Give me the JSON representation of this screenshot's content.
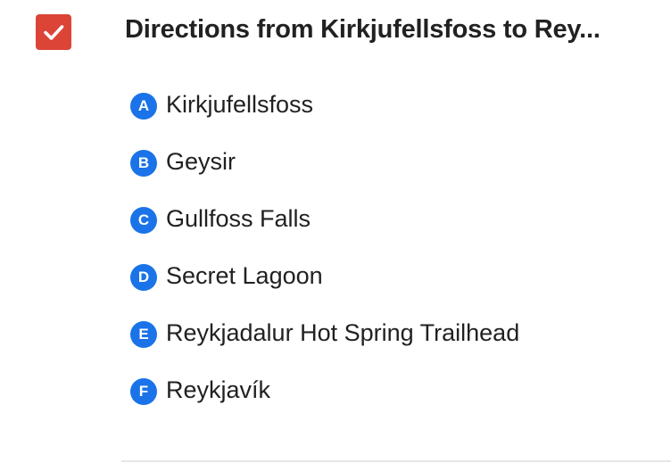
{
  "layer": {
    "checked": true,
    "checkbox_color": "#db4437",
    "title": "Directions from Kirkjufellsfoss to Rey..."
  },
  "marker_color": "#1a73e8",
  "stops": [
    {
      "letter": "A",
      "name": "Kirkjufellsfoss"
    },
    {
      "letter": "B",
      "name": "Geysir"
    },
    {
      "letter": "C",
      "name": "Gullfoss Falls"
    },
    {
      "letter": "D",
      "name": "Secret Lagoon"
    },
    {
      "letter": "E",
      "name": "Reykjadalur Hot Spring Trailhead"
    },
    {
      "letter": "F",
      "name": "Reykjavík"
    }
  ]
}
